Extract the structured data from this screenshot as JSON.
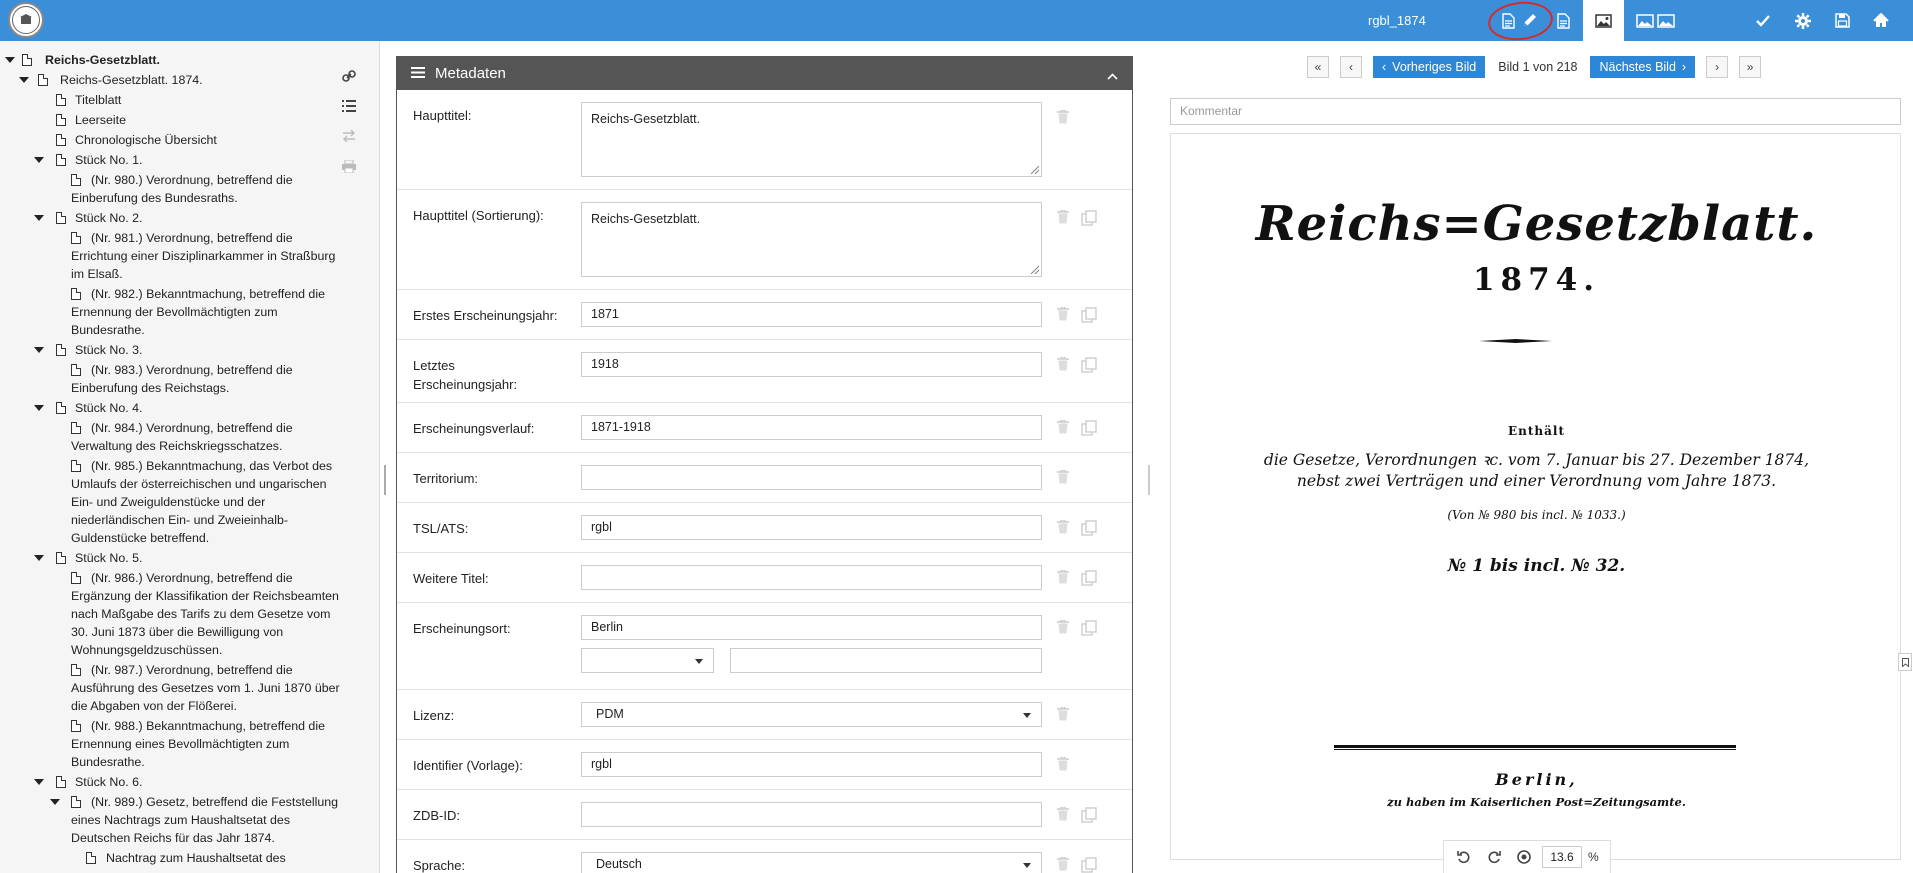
{
  "header": {
    "logo_text": "",
    "title": "rgbl_1874",
    "toolbar_icons": [
      "document-icon",
      "pencil-icon",
      "document-text-icon",
      "image-icon",
      "double-image-icon",
      "check-icon",
      "gear-icon",
      "save-icon",
      "home-icon"
    ]
  },
  "tree": {
    "items": [
      {
        "label": "Reichs-Gesetzblatt.",
        "level": 0,
        "expanded": true,
        "bold": true
      },
      {
        "label": "Reichs-Gesetzblatt. 1874.",
        "level": 1,
        "expanded": true
      },
      {
        "label": "Titelblatt",
        "level": 2
      },
      {
        "label": "Leerseite",
        "level": 2
      },
      {
        "label": "Chronologische Übersicht",
        "level": 2
      },
      {
        "label": "Stück No. 1.",
        "level": 2,
        "expanded": true
      },
      {
        "label": "(Nr. 980.) Verordnung, betreffend die Einberufung des Bundesraths.",
        "level": 3
      },
      {
        "label": "Stück No. 2.",
        "level": 2,
        "expanded": true
      },
      {
        "label": "(Nr. 981.) Verordnung, betreffend die Errichtung einer Disziplinarkammer in Straßburg im Elsaß.",
        "level": 3
      },
      {
        "label": "(Nr. 982.) Bekanntmachung, betreffend die Ernennung der Bevollmächtigten zum Bundesrathe.",
        "level": 3
      },
      {
        "label": "Stück No. 3.",
        "level": 2,
        "expanded": true
      },
      {
        "label": "(Nr. 983.) Verordnung, betreffend die Einberufung des Reichstags.",
        "level": 3
      },
      {
        "label": "Stück No. 4.",
        "level": 2,
        "expanded": true
      },
      {
        "label": "(Nr. 984.) Verordnung, betreffend die Verwaltung des Reichskriegsschatzes.",
        "level": 3
      },
      {
        "label": "(Nr. 985.) Bekanntmachung, das Verbot des Umlaufs der österreichischen und ungarischen Ein- und Zweiguldenstücke und der niederländischen Ein- und Zweieinhalb-Guldenstücke betreffend.",
        "level": 3
      },
      {
        "label": "Stück No. 5.",
        "level": 2,
        "expanded": true
      },
      {
        "label": "(Nr. 986.) Verordnung, betreffend die Ergänzung der Klassifikation der Reichsbeamten nach Maßgabe des Tarifs zu dem Gesetze vom 30. Juni 1873 über die Bewilligung von Wohnungsgeldzuschüssen.",
        "level": 3
      },
      {
        "label": "(Nr. 987.) Verordnung, betreffend die Ausführung des Gesetzes vom 1. Juni 1870 über die Abgaben von der Flößerei.",
        "level": 3
      },
      {
        "label": "(Nr. 988.) Bekanntmachung, betreffend die Ernennung eines Bevollmächtigten zum Bundesrathe.",
        "level": 3
      },
      {
        "label": "Stück No. 6.",
        "level": 2,
        "expanded": true
      },
      {
        "label": "(Nr. 989.) Gesetz, betreffend die Feststellung eines Nachtrags zum Haushaltsetat des Deutschen Reichs für das Jahr 1874.",
        "level": 3,
        "expanded": true
      },
      {
        "label": "Nachtrag zum Haushaltsetat des",
        "level": 4
      }
    ]
  },
  "metadata": {
    "panel_title": "Metadaten",
    "fields": {
      "haupttitel": {
        "label": "Haupttitel:",
        "value": "Reichs-Gesetzblatt."
      },
      "haupttitel_sort": {
        "label": "Haupttitel (Sortierung):",
        "value": "Reichs-Gesetzblatt."
      },
      "erstes_jahr": {
        "label": "Erstes Erscheinungsjahr:",
        "value": "1871"
      },
      "letztes_jahr": {
        "label": "Letztes Erscheinungsjahr:",
        "value": "1918"
      },
      "verlauf": {
        "label": "Erscheinungsverlauf:",
        "value": "1871-1918"
      },
      "territorium": {
        "label": "Territorium:",
        "value": ""
      },
      "tsl": {
        "label": "TSL/ATS:",
        "value": "rgbl"
      },
      "weitere": {
        "label": "Weitere Titel:",
        "value": ""
      },
      "ort": {
        "label": "Erscheinungsort:",
        "value": "Berlin"
      },
      "lizenz": {
        "label": "Lizenz:",
        "value": "PDM"
      },
      "identifier": {
        "label": "Identifier (Vorlage):",
        "value": "rgbl"
      },
      "zdb": {
        "label": "ZDB-ID:",
        "value": ""
      },
      "sprache": {
        "label": "Sprache:",
        "value": "Deutsch"
      }
    }
  },
  "viewer": {
    "first_label": "«",
    "prev_label": "‹",
    "prev_image": "Vorheriges Bild",
    "page_info": "Bild 1 von 218",
    "next_image": "Nächstes Bild",
    "next_label": "›",
    "last_label": "»",
    "comment_placeholder": "Kommentar",
    "zoom": "13.6",
    "zoom_unit": "%",
    "page": {
      "title": "Reichs=Gesetzblatt.",
      "year": "1874.",
      "enthaelt": "Enthält",
      "line1": "die Gesetze, Verordnungen ꝛc. vom 7. Januar bis 27. Dezember 1874,",
      "line2": "nebst zwei Verträgen und einer Verordnung vom Jahre 1873.",
      "line3": "(Von № 980 bis incl. № 1033.)",
      "line4": "№ 1 bis incl. № 32.",
      "city": "Berlin,",
      "footer": "zu haben im Kaiserlichen Post=Zeitungsamte."
    }
  }
}
